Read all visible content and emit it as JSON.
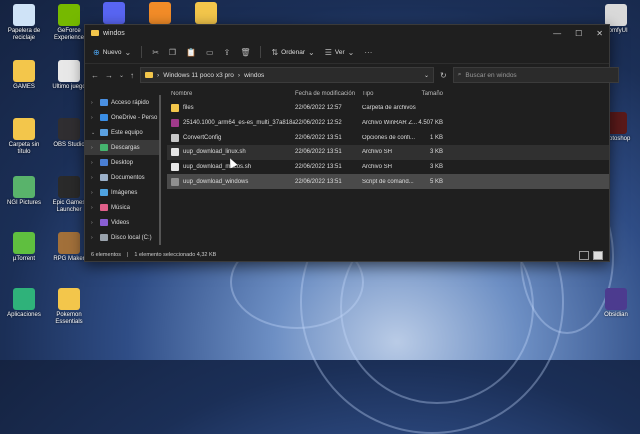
{
  "desktop": {
    "icons_left": [
      {
        "label": "Papelera de reciclaje",
        "icon": "recycle-bin-icon",
        "color": "#cfe3f7"
      },
      {
        "label": "GAMES",
        "icon": "folder-icon",
        "color": "#f3c64b"
      },
      {
        "label": "Carpeta sin título",
        "icon": "folder-icon",
        "color": "#f3c64b"
      },
      {
        "label": "NGI Pictures",
        "icon": "app-icon",
        "color": "#59b36b"
      },
      {
        "label": "µTorrent",
        "icon": "utorrent-icon",
        "color": "#5fbf3f"
      },
      {
        "label": "Aplicaciones",
        "icon": "app-icon",
        "color": "#2fb27a"
      }
    ],
    "icons_col2": [
      {
        "label": "GeForce Experience",
        "icon": "nvidia-icon",
        "color": "#76b900"
      },
      {
        "label": "Ultimo juego",
        "icon": "file-icon",
        "color": "#e8e8e8"
      },
      {
        "label": "OBS Studio",
        "icon": "obs-icon",
        "color": "#302e31"
      },
      {
        "label": "Epic Games Launcher",
        "icon": "epic-icon",
        "color": "#2a2a2a"
      },
      {
        "label": "RPG Maker",
        "icon": "game-icon",
        "color": "#a2703a"
      },
      {
        "label": "Pokemon Essentials",
        "icon": "folder-icon",
        "color": "#f3c64b"
      }
    ],
    "icons_top": [
      {
        "label": "Discord",
        "icon": "discord-icon",
        "color": "#5865f2"
      },
      {
        "label": "FL Studio",
        "icon": "flstudio-icon",
        "color": "#f28c28"
      },
      {
        "label": "Carpeta",
        "icon": "folder-icon",
        "color": "#f3c64b"
      }
    ],
    "icons_right": [
      {
        "label": "ComfyUI",
        "icon": "app-icon",
        "color": "#d9d9d9"
      },
      {
        "label": "Photoshop",
        "icon": "photoshop-icon",
        "color": "#5a1a1a"
      },
      {
        "label": "Obsidian",
        "icon": "obsidian-icon",
        "color": "#4c3b8f"
      }
    ]
  },
  "window": {
    "title": "windos",
    "toolbar": {
      "new_label": "Nuevo",
      "sort_label": "Ordenar",
      "view_label": "Ver",
      "more_label": "···"
    },
    "breadcrumb": [
      "Windows 11 poco x3 pro",
      "windos"
    ],
    "search_placeholder": "Buscar en windos",
    "sidebar": [
      {
        "label": "Acceso rápido",
        "icon": "star-icon",
        "color": "#4a90e2",
        "chev": "›",
        "active": false
      },
      {
        "label": "OneDrive - Perso",
        "icon": "cloud-icon",
        "color": "#3a8ee6",
        "chev": "›",
        "active": false
      },
      {
        "label": "Este equipo",
        "icon": "computer-icon",
        "color": "#5aa0e0",
        "chev": "⌄",
        "active": false
      },
      {
        "label": "Descargas",
        "icon": "download-icon",
        "color": "#45b56f",
        "chev": "›",
        "active": true
      },
      {
        "label": "Desktop",
        "icon": "desktop-icon",
        "color": "#4a7fd4",
        "chev": "›",
        "active": false
      },
      {
        "label": "Documentos",
        "icon": "documents-icon",
        "color": "#9bb0c9",
        "chev": "›",
        "active": false
      },
      {
        "label": "Imágenes",
        "icon": "pictures-icon",
        "color": "#4fa3e0",
        "chev": "›",
        "active": false
      },
      {
        "label": "Música",
        "icon": "music-icon",
        "color": "#e0608a",
        "chev": "›",
        "active": false
      },
      {
        "label": "Videos",
        "icon": "videos-icon",
        "color": "#8a5fd4",
        "chev": "›",
        "active": false
      },
      {
        "label": "Disco local (C:)",
        "icon": "drive-icon",
        "color": "#9aa3ad",
        "chev": "›",
        "active": false
      }
    ],
    "columns": {
      "name": "Nombre",
      "date": "Fecha de modificación",
      "type": "Tipo",
      "size": "Tamaño"
    },
    "files": [
      {
        "name": "files",
        "date": "22/06/2022 12:57",
        "type": "Carpeta de archivos",
        "size": "",
        "color": "#f3c64b",
        "state": ""
      },
      {
        "name": "25140.1000_arm64_es-es_multi_37a818af...",
        "date": "22/06/2022 12:52",
        "type": "Archivo WinRAR Z...",
        "size": "4.507 KB",
        "color": "#a03a8a",
        "state": ""
      },
      {
        "name": "ConvertConfig",
        "date": "22/06/2022 13:51",
        "type": "Opciones de confi...",
        "size": "1 KB",
        "color": "#c8c8c8",
        "state": ""
      },
      {
        "name": "uup_download_linux.sh",
        "date": "22/06/2022 13:51",
        "type": "Archivo SH",
        "size": "3 KB",
        "color": "#e6e6e6",
        "state": "hover"
      },
      {
        "name": "uup_download_macos.sh",
        "date": "22/06/2022 13:51",
        "type": "Archivo SH",
        "size": "3 KB",
        "color": "#e6e6e6",
        "state": ""
      },
      {
        "name": "uup_download_windows",
        "date": "22/06/2022 13:51",
        "type": "Script de comand...",
        "size": "5 KB",
        "color": "#8f8f8f",
        "state": "selected"
      }
    ],
    "status": {
      "count": "6 elementos",
      "selection": "1 elemento seleccionado  4,32 KB"
    }
  }
}
